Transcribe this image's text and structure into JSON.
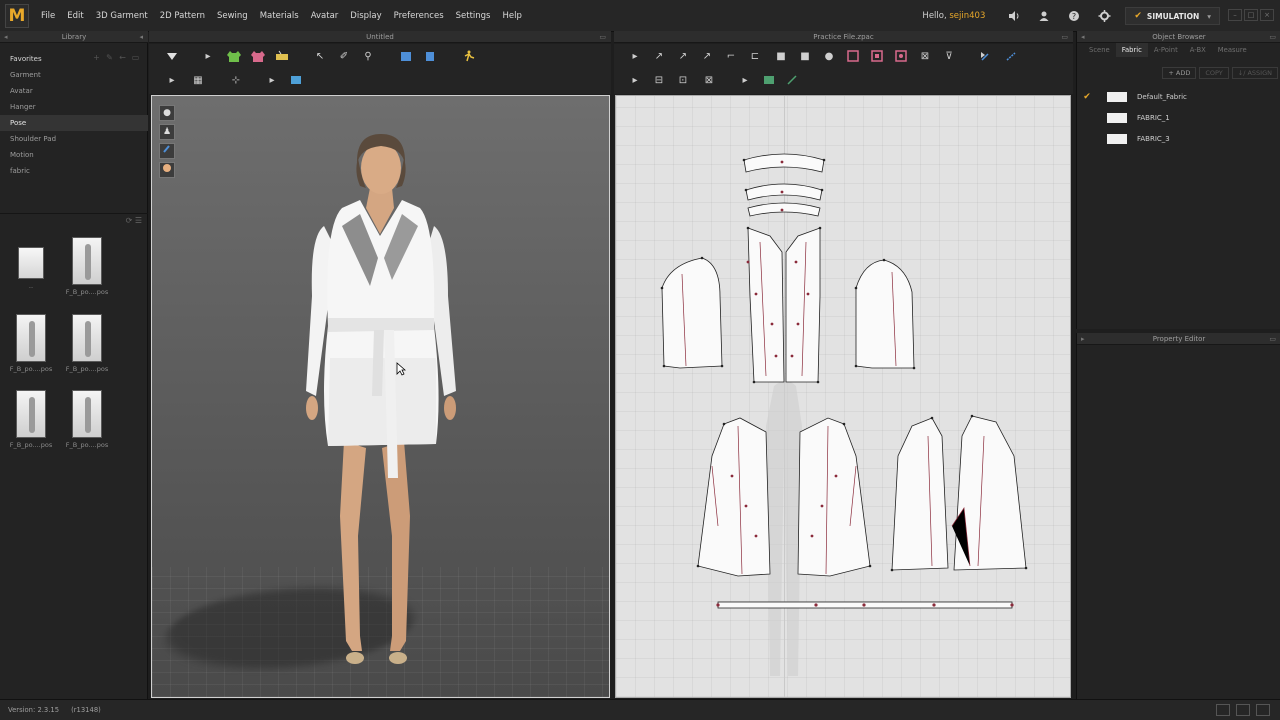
{
  "app": {
    "logo_letter": "M",
    "menus": [
      "File",
      "Edit",
      "3D Garment",
      "2D Pattern",
      "Sewing",
      "Materials",
      "Avatar",
      "Display",
      "Preferences",
      "Settings",
      "Help"
    ],
    "greeting": "Hello,",
    "user": "sejin403",
    "mode_button": "SIMULATION",
    "accent_color": "#e8a82a"
  },
  "library": {
    "title": "Library",
    "items": [
      "Favorites",
      "Garment",
      "Avatar",
      "Hanger",
      "Pose",
      "Shoulder Pad",
      "Motion",
      "fabric"
    ],
    "active_item": "Pose",
    "thumbs": [
      {
        "caption": ".."
      },
      {
        "caption": "F_B_po....pos"
      },
      {
        "caption": "F_B_po....pos"
      },
      {
        "caption": "F_B_po....pos"
      },
      {
        "caption": "F_B_po....pos"
      },
      {
        "caption": "F_B_po....pos"
      }
    ]
  },
  "view3d": {
    "title": "Untitled"
  },
  "view2d": {
    "title": "Practice File.zpac"
  },
  "object_browser": {
    "title": "Object Browser",
    "tabs": [
      "Scene",
      "Fabric",
      "A-Point",
      "A-BX",
      "Measure"
    ],
    "active_tab": "Fabric",
    "actions": {
      "add": "+ ADD",
      "copy": "COPY",
      "assign": "↓/ ASSIGN"
    },
    "fabrics": [
      {
        "name": "Default_Fabric",
        "selected": true
      },
      {
        "name": "FABRIC_1",
        "selected": false
      },
      {
        "name": "FABRIC_3",
        "selected": false
      }
    ]
  },
  "property_editor": {
    "title": "Property Editor"
  },
  "status": {
    "version": "Version: 2.3.15",
    "build": "(r13148)"
  },
  "icons": {
    "sound": "speaker-icon",
    "user": "user-icon",
    "help": "help-icon",
    "settings": "gear-icon"
  }
}
